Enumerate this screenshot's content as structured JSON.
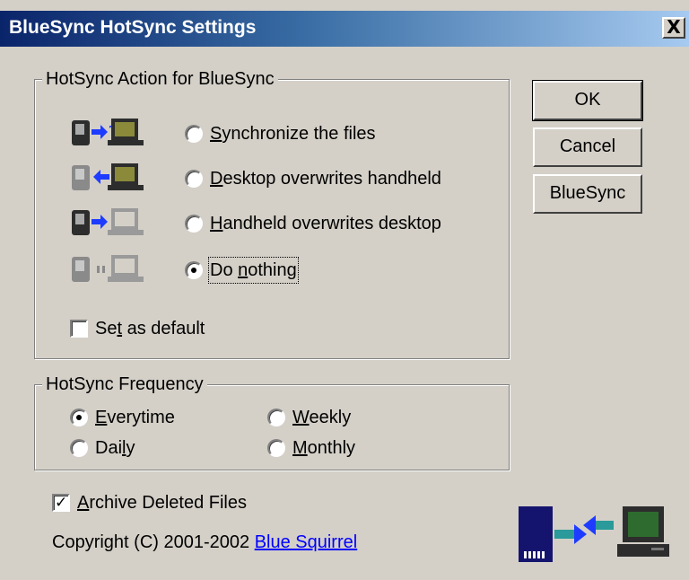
{
  "window": {
    "title": "BlueSync HotSync Settings",
    "close_label": "X"
  },
  "buttons": {
    "ok": "OK",
    "cancel": "Cancel",
    "bluesync": "BlueSync"
  },
  "action_group": {
    "title": "HotSync Action for BlueSync",
    "options": [
      {
        "label": "Synchronize the files",
        "accel": "S",
        "rest": "ynchronize the files",
        "checked": false
      },
      {
        "label": "Desktop overwrites handheld",
        "accel": "D",
        "rest": "esktop overwrites handheld",
        "checked": false
      },
      {
        "label": "Handheld overwrites desktop",
        "accel": "H",
        "rest": "andheld overwrites desktop",
        "checked": false
      },
      {
        "label": "Do nothing",
        "pre": "Do ",
        "accel": "n",
        "rest": "othing",
        "checked": true
      }
    ],
    "set_default": {
      "pre": "Se",
      "accel": "t",
      "rest": " as default",
      "checked": false
    }
  },
  "frequency_group": {
    "title": "HotSync Frequency",
    "options": [
      {
        "label": "Everytime",
        "accel": "E",
        "rest": "verytime",
        "checked": true
      },
      {
        "label": "Weekly",
        "accel": "W",
        "rest": "eekly",
        "checked": false
      },
      {
        "label": "Daily",
        "pre": "Dai",
        "accel": "l",
        "rest": "y",
        "checked": false
      },
      {
        "label": "Monthly",
        "accel": "M",
        "rest": "onthly",
        "checked": false
      }
    ]
  },
  "archive": {
    "accel": "A",
    "rest": "rchive Deleted Files",
    "checked": true
  },
  "copyright": {
    "text": "Copyright (C) 2001-2002",
    "link": "Blue Squirrel"
  },
  "colors": {
    "handheld": "#2d2d2d",
    "desktop_screen": "#2e6b2e",
    "arrow": "#1e3cff",
    "teal": "#2a9a9a",
    "card": "#14146e"
  }
}
